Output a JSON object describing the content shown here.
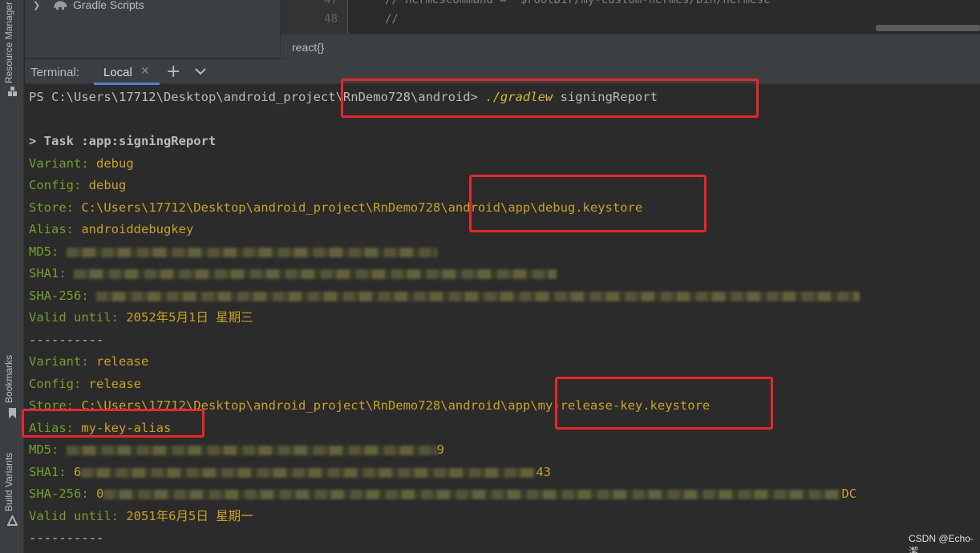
{
  "side_tools": {
    "resource_manager": "Resource Manager",
    "bookmarks": "Bookmarks",
    "build_variants": "Build Variants"
  },
  "project_tree": {
    "item_label": "Gradle Scripts"
  },
  "editor": {
    "lines": [
      {
        "no": "47",
        "text": "// hermesCommand = \"$rootDir/my-custom-hermes/bin/hermesc\""
      },
      {
        "no": "48",
        "text": "//"
      }
    ],
    "breadcrumb": "react{}"
  },
  "terminal": {
    "title": "Terminal:",
    "tab_label": "Local",
    "prompt_prefix": "PS C:\\Users\\17712\\Desktop\\android_project\\RnDemo728\\android> ",
    "command": "./gradlew",
    "command_args": " signingReport",
    "task": "> Task :app:signingReport",
    "debug": {
      "variant_key": "Variant: ",
      "variant": "debug",
      "config_key": "Config: ",
      "config": "debug",
      "store_key": "Store: ",
      "store": "C:\\Users\\17712\\Desktop\\android_project\\RnDemo728\\android\\app\\debug.keystore",
      "alias_key": "Alias: ",
      "alias": "androiddebugkey",
      "md5_key": "MD5: ",
      "sha1_key": "SHA1: ",
      "sha256_key": "SHA-256: ",
      "valid_key": "Valid until: ",
      "valid": "2052年5月1日 星期三"
    },
    "separator": "----------",
    "release": {
      "variant_key": "Variant: ",
      "variant": "release",
      "config_key": "Config: ",
      "config": "release",
      "store_key": "Store: ",
      "store": "C:\\Users\\17712\\Desktop\\android_project\\RnDemo728\\android\\app\\my-release-key.keystore",
      "alias_key": "Alias: ",
      "alias": "my-key-alias",
      "md5_key": "MD5: ",
      "md5_tail": "9",
      "sha1_key": "SHA1: ",
      "sha1_head": "6",
      "sha1_tail": "43",
      "sha256_key": "SHA-256: ",
      "sha256_head": "0",
      "sha256_tail": "DC",
      "valid_key": "Valid until: ",
      "valid": "2051年6月5日 星期一"
    }
  },
  "watermark": "CSDN @Echo-潔",
  "colors": {
    "annotation_red": "#e8262c",
    "terminal_green": "#769d2c",
    "terminal_yellow": "#c9a227"
  }
}
